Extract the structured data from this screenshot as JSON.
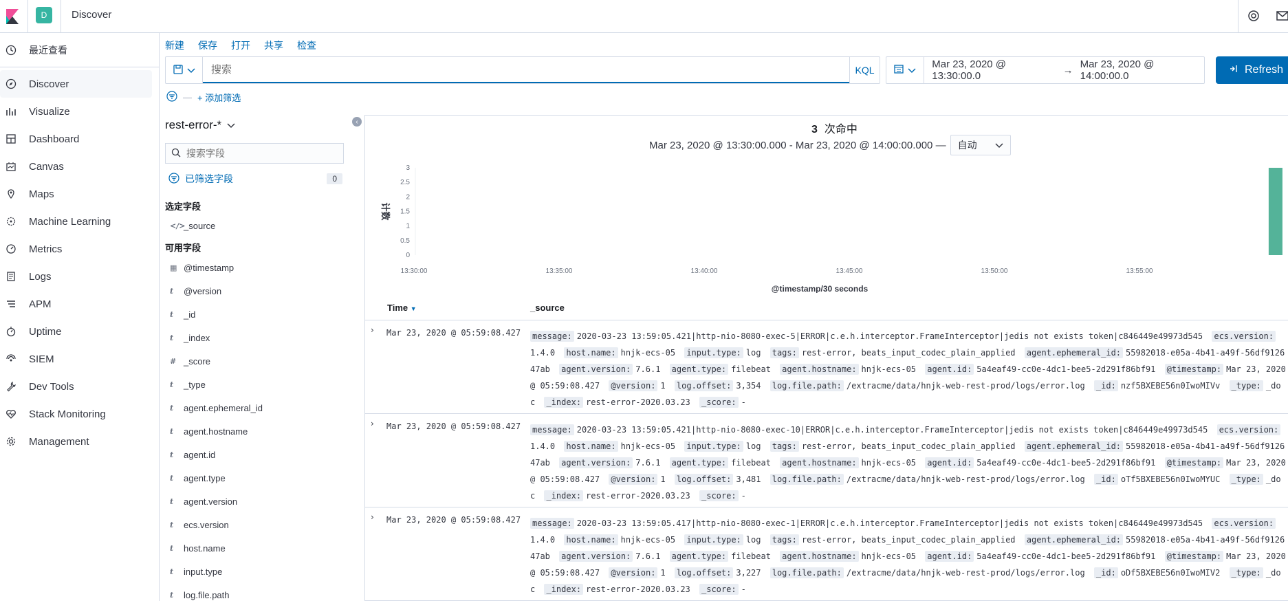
{
  "header": {
    "space_letter": "D",
    "title": "Discover"
  },
  "nav": {
    "recent": "最近查看",
    "items": [
      {
        "label": "Discover",
        "icon": "compass-icon"
      },
      {
        "label": "Visualize",
        "icon": "bar-chart-icon"
      },
      {
        "label": "Dashboard",
        "icon": "dashboard-icon"
      },
      {
        "label": "Canvas",
        "icon": "canvas-icon"
      },
      {
        "label": "Maps",
        "icon": "map-icon"
      },
      {
        "label": "Machine Learning",
        "icon": "ml-icon"
      },
      {
        "label": "Metrics",
        "icon": "metrics-icon"
      },
      {
        "label": "Logs",
        "icon": "logs-icon"
      },
      {
        "label": "APM",
        "icon": "apm-icon"
      },
      {
        "label": "Uptime",
        "icon": "uptime-icon"
      },
      {
        "label": "SIEM",
        "icon": "siem-icon"
      },
      {
        "label": "Dev Tools",
        "icon": "wrench-icon"
      },
      {
        "label": "Stack Monitoring",
        "icon": "heartbeat-icon"
      },
      {
        "label": "Management",
        "icon": "gear-icon"
      }
    ]
  },
  "topmenu": {
    "new": "新建",
    "save": "保存",
    "open": "打开",
    "share": "共享",
    "inspect": "检查"
  },
  "query": {
    "placeholder": "搜索",
    "kql": "KQL"
  },
  "date": {
    "start": "Mar 23, 2020 @ 13:30:00.0",
    "arrow": "→",
    "end": "Mar 23, 2020 @ 14:00:00.0"
  },
  "refresh": "Refresh",
  "filter": {
    "dash": "—",
    "add": "+ 添加筛选"
  },
  "sidebar": {
    "index_pattern": "rest-error-*",
    "field_search_placeholder": "搜索字段",
    "selected_filter_label": "已筛选字段",
    "selected_filter_count": "0",
    "selected_title": "选定字段",
    "selected_fields": [
      {
        "type": "</>",
        "name": "_source"
      }
    ],
    "available_title": "可用字段",
    "available_fields": [
      {
        "type": "▦",
        "name": "@timestamp"
      },
      {
        "type": "t",
        "name": "@version"
      },
      {
        "type": "t",
        "name": "_id"
      },
      {
        "type": "t",
        "name": "_index"
      },
      {
        "type": "#",
        "name": "_score"
      },
      {
        "type": "t",
        "name": "_type"
      },
      {
        "type": "t",
        "name": "agent.ephemeral_id"
      },
      {
        "type": "t",
        "name": "agent.hostname"
      },
      {
        "type": "t",
        "name": "agent.id"
      },
      {
        "type": "t",
        "name": "agent.type"
      },
      {
        "type": "t",
        "name": "agent.version"
      },
      {
        "type": "t",
        "name": "ecs.version"
      },
      {
        "type": "t",
        "name": "host.name"
      },
      {
        "type": "t",
        "name": "input.type"
      },
      {
        "type": "t",
        "name": "log.file.path"
      }
    ]
  },
  "hits": {
    "count": "3",
    "label": "次命中"
  },
  "range": {
    "text": "Mar 23, 2020 @ 13:30:00.000 - Mar 23, 2020 @ 14:00:00.000 —",
    "interval": "自动"
  },
  "chart_data": {
    "type": "bar",
    "ylabel": "计数",
    "xlabel": "@timestamp/30 seconds",
    "yticks": [
      "0",
      "0.5",
      "1",
      "1.5",
      "2",
      "2.5",
      "3"
    ],
    "ylim": [
      0,
      3
    ],
    "xticks": [
      "13:30:00",
      "13:35:00",
      "13:40:00",
      "13:45:00",
      "13:50:00",
      "13:55:00"
    ],
    "xlim_minutes": [
      0,
      30
    ],
    "bars": [
      {
        "x_minute": 29.5,
        "value": 3
      }
    ],
    "color": "#54b399"
  },
  "table": {
    "col_time": "Time",
    "col_source": "_source",
    "rows": [
      {
        "time": "Mar 23, 2020 @ 05:59:08.427",
        "fields": [
          [
            "message:",
            "2020-03-23 13:59:05.421|http-nio-8080-exec-5|ERROR|c.e.h.interceptor.FrameInterceptor|jedis not exists token|c846449e49973d545"
          ],
          [
            "ecs.version:",
            "1.4.0"
          ],
          [
            "host.name:",
            "hnjk-ecs-05"
          ],
          [
            "input.type:",
            "log"
          ],
          [
            "tags:",
            "rest-error, beats_input_codec_plain_applied"
          ],
          [
            "agent.ephemeral_id:",
            "55982018-e05a-4b41-a49f-56df912647ab"
          ],
          [
            "agent.version:",
            "7.6.1"
          ],
          [
            "agent.type:",
            "filebeat"
          ],
          [
            "agent.hostname:",
            "hnjk-ecs-05"
          ],
          [
            "agent.id:",
            "5a4eaf49-cc0e-4dc1-bee5-2d291f86bf91"
          ],
          [
            "@timestamp:",
            "Mar 23, 2020 @ 05:59:08.427"
          ],
          [
            "@version:",
            "1"
          ],
          [
            "log.offset:",
            "3,354"
          ],
          [
            "log.file.path:",
            "/extracme/data/hnjk-web-rest-prod/logs/error.log"
          ],
          [
            "_id:",
            "nzf5BXEBE56n0IwoMIVv"
          ],
          [
            "_type:",
            "_doc"
          ],
          [
            "_index:",
            "rest-error-2020.03.23"
          ],
          [
            "_score:",
            "-"
          ]
        ]
      },
      {
        "time": "Mar 23, 2020 @ 05:59:08.427",
        "fields": [
          [
            "message:",
            "2020-03-23 13:59:05.421|http-nio-8080-exec-10|ERROR|c.e.h.interceptor.FrameInterceptor|jedis not exists token|c846449e49973d545"
          ],
          [
            "ecs.version:",
            "1.4.0"
          ],
          [
            "host.name:",
            "hnjk-ecs-05"
          ],
          [
            "input.type:",
            "log"
          ],
          [
            "tags:",
            "rest-error, beats_input_codec_plain_applied"
          ],
          [
            "agent.ephemeral_id:",
            "55982018-e05a-4b41-a49f-56df912647ab"
          ],
          [
            "agent.version:",
            "7.6.1"
          ],
          [
            "agent.type:",
            "filebeat"
          ],
          [
            "agent.hostname:",
            "hnjk-ecs-05"
          ],
          [
            "agent.id:",
            "5a4eaf49-cc0e-4dc1-bee5-2d291f86bf91"
          ],
          [
            "@timestamp:",
            "Mar 23, 2020 @ 05:59:08.427"
          ],
          [
            "@version:",
            "1"
          ],
          [
            "log.offset:",
            "3,481"
          ],
          [
            "log.file.path:",
            "/extracme/data/hnjk-web-rest-prod/logs/error.log"
          ],
          [
            "_id:",
            "oTf5BXEBE56n0IwoMYUC"
          ],
          [
            "_type:",
            "_doc"
          ],
          [
            "_index:",
            "rest-error-2020.03.23"
          ],
          [
            "_score:",
            "-"
          ]
        ]
      },
      {
        "time": "Mar 23, 2020 @ 05:59:08.427",
        "fields": [
          [
            "message:",
            "2020-03-23 13:59:05.417|http-nio-8080-exec-1|ERROR|c.e.h.interceptor.FrameInterceptor|jedis not exists token|c846449e49973d545"
          ],
          [
            "ecs.version:",
            "1.4.0"
          ],
          [
            "host.name:",
            "hnjk-ecs-05"
          ],
          [
            "input.type:",
            "log"
          ],
          [
            "tags:",
            "rest-error, beats_input_codec_plain_applied"
          ],
          [
            "agent.ephemeral_id:",
            "55982018-e05a-4b41-a49f-56df912647ab"
          ],
          [
            "agent.version:",
            "7.6.1"
          ],
          [
            "agent.type:",
            "filebeat"
          ],
          [
            "agent.hostname:",
            "hnjk-ecs-05"
          ],
          [
            "agent.id:",
            "5a4eaf49-cc0e-4dc1-bee5-2d291f86bf91"
          ],
          [
            "@timestamp:",
            "Mar 23, 2020 @ 05:59:08.427"
          ],
          [
            "@version:",
            "1"
          ],
          [
            "log.offset:",
            "3,227"
          ],
          [
            "log.file.path:",
            "/extracme/data/hnjk-web-rest-prod/logs/error.log"
          ],
          [
            "_id:",
            "oDf5BXEBE56n0IwoMIV2"
          ],
          [
            "_type:",
            "_doc"
          ],
          [
            "_index:",
            "rest-error-2020.03.23"
          ],
          [
            "_score:",
            "-"
          ]
        ]
      }
    ]
  }
}
